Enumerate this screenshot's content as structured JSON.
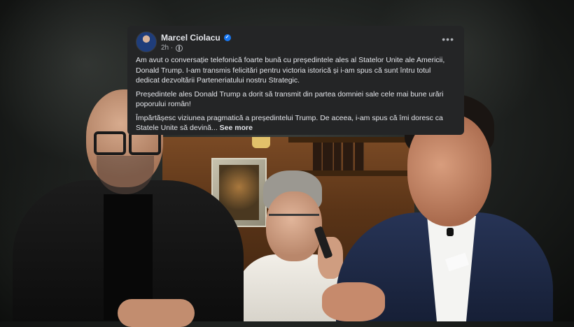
{
  "post": {
    "author": "Marcel Ciolacu",
    "time": "2h ·",
    "paragraphs": [
      "Am avut o conversație telefonică foarte bună cu președintele ales al Statelor Unite ale Americii, Donald Trump. I-am transmis felicitări pentru victoria istorică și i-am spus că sunt întru totul dedicat dezvoltării Parteneriatului nostru Strategic.",
      "Președintele ales Donald Trump a dorit să transmit din partea domniei sale cele mai bune urări poporului român!",
      "Împărtășesc viziunea pragmatică a președintelui Trump. De aceea, i-am spus că îmi doresc ca Statele Unite să devină..."
    ],
    "see_more": "See more",
    "icons": {
      "verified": "verified-badge-icon",
      "audience": "globe-icon",
      "options": "more-options-icon"
    }
  },
  "colors": {
    "card_bg": "#242526",
    "text": "#e4e6eb",
    "muted": "#b0b3b8",
    "verified": "#1877f2"
  }
}
